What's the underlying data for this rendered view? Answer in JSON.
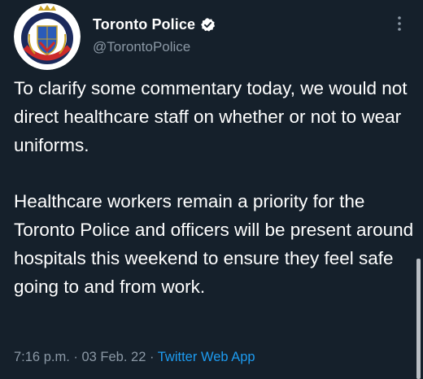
{
  "author": {
    "display_name": "Toronto Police",
    "handle": "@TorontoPolice",
    "avatar_icon": "toronto-police-crest-icon",
    "verified_icon": "verified-badge-icon"
  },
  "tweet": {
    "paragraphs": [
      "To clarify some commentary today, we would not direct healthcare staff on whether or not to wear uniforms.",
      "Healthcare workers remain a priority for the Toronto Police and officers will be present around hospitals this weekend to ensure they feel safe going to and from work."
    ],
    "time": "7:16 p.m.",
    "separator_1": "·",
    "date": "03 Feb. 22",
    "separator_2": "·",
    "source": "Twitter Web App"
  },
  "menu": {
    "more_icon": "more-vertical-icon"
  },
  "colors": {
    "background": "#15202b",
    "primary_text": "#ffffff",
    "secondary_text": "#8b98a5",
    "link": "#1d9bf0"
  }
}
